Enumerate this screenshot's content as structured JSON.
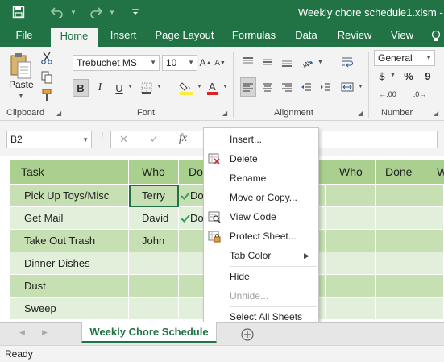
{
  "window": {
    "title": "Weekly chore schedule1.xlsm -",
    "accent_color": "#217346"
  },
  "ribbon_tabs": [
    "File",
    "Home",
    "Insert",
    "Page Layout",
    "Formulas",
    "Data",
    "Review",
    "View"
  ],
  "active_tab": "Home",
  "ribbon": {
    "clipboard": {
      "paste_label": "Paste",
      "group_label": "Clipboard"
    },
    "font": {
      "name": "Trebuchet MS",
      "size": "10",
      "group_label": "Font",
      "bold": "B",
      "italic": "I",
      "underline": "U"
    },
    "alignment": {
      "group_label": "Alignment"
    },
    "number": {
      "format": "General",
      "group_label": "Number",
      "currency": "$",
      "percent": "%",
      "comma": "9",
      "inc_decimal": ".00",
      "dec_decimal": ".0"
    }
  },
  "formula_bar": {
    "name_box": "B2",
    "cancel": "✕",
    "enter": "✓",
    "fx": "fx",
    "value": ""
  },
  "sheet": {
    "header_left": [
      "Task",
      "Who",
      "Do"
    ],
    "header_right": [
      "Who",
      "Done",
      "W"
    ],
    "rows": [
      {
        "task": "Pick Up Toys/Misc",
        "who": "Terry",
        "done": "Do"
      },
      {
        "task": "Get Mail",
        "who": "David",
        "done": "Do"
      },
      {
        "task": "Take Out Trash",
        "who": "John",
        "done": ""
      },
      {
        "task": "Dinner Dishes",
        "who": "",
        "done": ""
      },
      {
        "task": "Dust",
        "who": "",
        "done": ""
      },
      {
        "task": "Sweep",
        "who": "",
        "done": ""
      }
    ],
    "colors": {
      "header_bg": "#a9d08e",
      "row_dark": "#c6e0b4",
      "row_light": "#e2efda"
    }
  },
  "context_menu": {
    "items": [
      {
        "label": "Insert...",
        "enabled": true,
        "icon": ""
      },
      {
        "label": "Delete",
        "enabled": true,
        "icon": "delete-sheet-icon"
      },
      {
        "label": "Rename",
        "enabled": true,
        "icon": ""
      },
      {
        "label": "Move or Copy...",
        "enabled": true,
        "icon": ""
      },
      {
        "label": "View Code",
        "enabled": true,
        "icon": "view-code-icon"
      },
      {
        "label": "Protect Sheet...",
        "enabled": true,
        "icon": "protect-sheet-icon"
      },
      {
        "label": "Tab Color",
        "enabled": true,
        "icon": "",
        "submenu": true
      },
      {
        "label": "Hide",
        "enabled": true,
        "icon": ""
      },
      {
        "label": "Unhide...",
        "enabled": false,
        "icon": ""
      },
      {
        "label": "Select All Sheets",
        "enabled": true,
        "icon": ""
      }
    ]
  },
  "sheet_tabs": {
    "active": "Weekly Chore Schedule",
    "add_icon": "plus-circle-icon"
  },
  "status_bar": {
    "text": "Ready"
  }
}
